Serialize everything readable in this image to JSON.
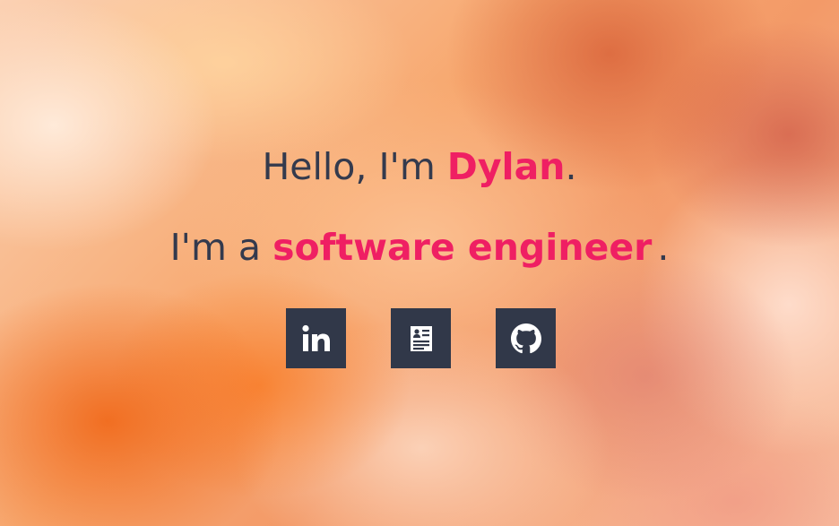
{
  "intro": {
    "greeting": "Hello, I'm ",
    "name": "Dylan",
    "greeting_end": ".",
    "prefix": "I'm a ",
    "role": "software engineer",
    "role_end": "."
  },
  "socials": [
    {
      "icon": "linkedin-icon"
    },
    {
      "icon": "resume-icon"
    },
    {
      "icon": "github-icon"
    }
  ],
  "colors": {
    "accent": "#ef1f63",
    "text": "#343a4d",
    "button_bg": "#313849",
    "icon": "#ffffff"
  }
}
